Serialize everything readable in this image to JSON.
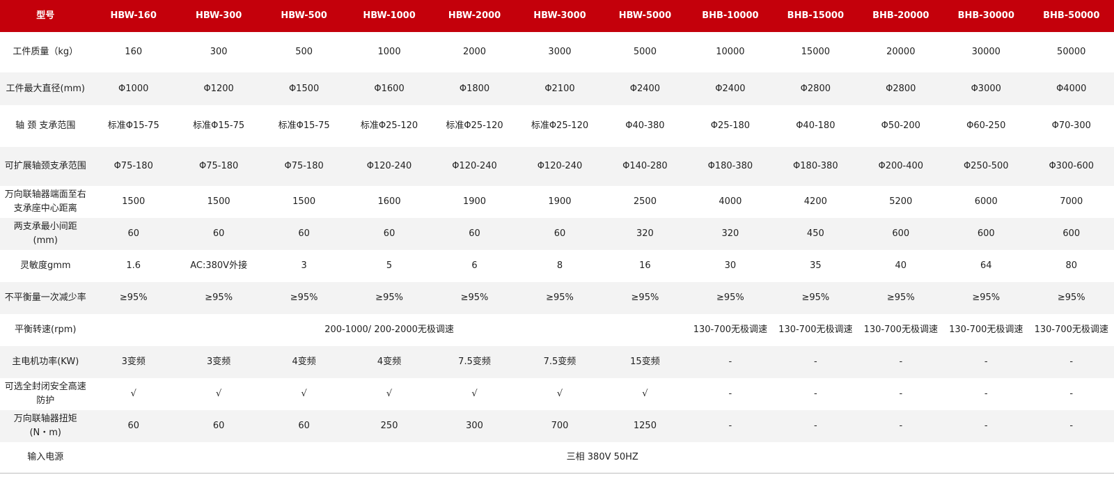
{
  "table": {
    "header": [
      "型号",
      "HBW-160",
      "HBW-300",
      "HBW-500",
      "HBW-1000",
      "HBW-2000",
      "HBW-3000",
      "HBW-5000",
      "BHB-10000",
      "BHB-15000",
      "BHB-20000",
      "BHB-30000",
      "BHB-50000"
    ],
    "rows": [
      {
        "label": "工件质量（kg）",
        "values": [
          "160",
          "300",
          "500",
          "1000",
          "2000",
          "3000",
          "5000",
          "10000",
          "15000",
          "20000",
          "30000",
          "50000"
        ]
      },
      {
        "label": "工件最大直径(mm)",
        "values": [
          "Φ1000",
          "Φ1200",
          "Φ1500",
          "Φ1600",
          "Φ1800",
          "Φ2100",
          "Φ2400",
          "Φ2400",
          "Φ2800",
          "Φ2800",
          "Φ3000",
          "Φ4000"
        ]
      },
      {
        "label": "轴 颈 支承范围",
        "values": [
          "标准Φ15-75",
          "标准Φ15-75",
          "标准Φ15-75",
          "标准Φ25-120",
          "标准Φ25-120",
          "标准Φ25-120",
          "Φ40-380",
          "Φ25-180",
          "Φ40-180",
          "Φ50-200",
          "Φ60-250",
          "Φ70-300"
        ]
      },
      {
        "label": "可扩展轴颈支承范围",
        "values": [
          "Φ75-180",
          "Φ75-180",
          "Φ75-180",
          "Φ120-240",
          "Φ120-240",
          "Φ120-240",
          "Φ140-280",
          "Φ180-380",
          "Φ180-380",
          "Φ200-400",
          "Φ250-500",
          "Φ300-600"
        ]
      },
      {
        "label_line1": "万向联轴器端面至右",
        "label_line2": "支承座中心距离",
        "values": [
          "1500",
          "1500",
          "1500",
          "1600",
          "1900",
          "1900",
          "2500",
          "4000",
          "4200",
          "5200",
          "6000",
          "7000"
        ]
      },
      {
        "label_line1": "两支承最小间距",
        "label_line2": "(mm)",
        "values": [
          "60",
          "60",
          "60",
          "60",
          "60",
          "60",
          "320",
          "320",
          "450",
          "600",
          "600",
          "600"
        ]
      },
      {
        "label": "灵敏度gmm",
        "values": [
          "1.6",
          "AC:380V外接",
          "3",
          "5",
          "6",
          "8",
          "16",
          "30",
          "35",
          "40",
          "64",
          "80"
        ]
      },
      {
        "label": "不平衡量一次减少率",
        "values": [
          "≥95%",
          "≥95%",
          "≥95%",
          "≥95%",
          "≥95%",
          "≥95%",
          "≥95%",
          "≥95%",
          "≥95%",
          "≥95%",
          "≥95%",
          "≥95%"
        ]
      },
      {
        "label": "平衡转速(rpm)",
        "merged": "200-1000/ 200-2000无极调速",
        "values": [
          "130-700无极调速",
          "130-700无极调速",
          "130-700无极调速",
          "130-700无极调速",
          "130-700无极调速"
        ]
      },
      {
        "label": "主电机功率(KW)",
        "values": [
          "3变频",
          "3变频",
          "4变频",
          "4变频",
          "7.5变频",
          "7.5变频",
          "15变频",
          "-",
          "-",
          "-",
          "-",
          "-"
        ]
      },
      {
        "label_line1": "可选全封闭安全高速",
        "label_line2": "防护",
        "values": [
          "√",
          "√",
          "√",
          "√",
          "√",
          "√",
          "√",
          "-",
          "-",
          "-",
          "-",
          "-"
        ]
      },
      {
        "label_line1": "万向联轴器扭矩",
        "label_line2": "(N・m)",
        "values": [
          "60",
          "60",
          "60",
          "250",
          "300",
          "700",
          "1250",
          "-",
          "-",
          "-",
          "-",
          "-"
        ]
      },
      {
        "label": "输入电源",
        "merged": "三相 380V 50HZ"
      }
    ]
  }
}
